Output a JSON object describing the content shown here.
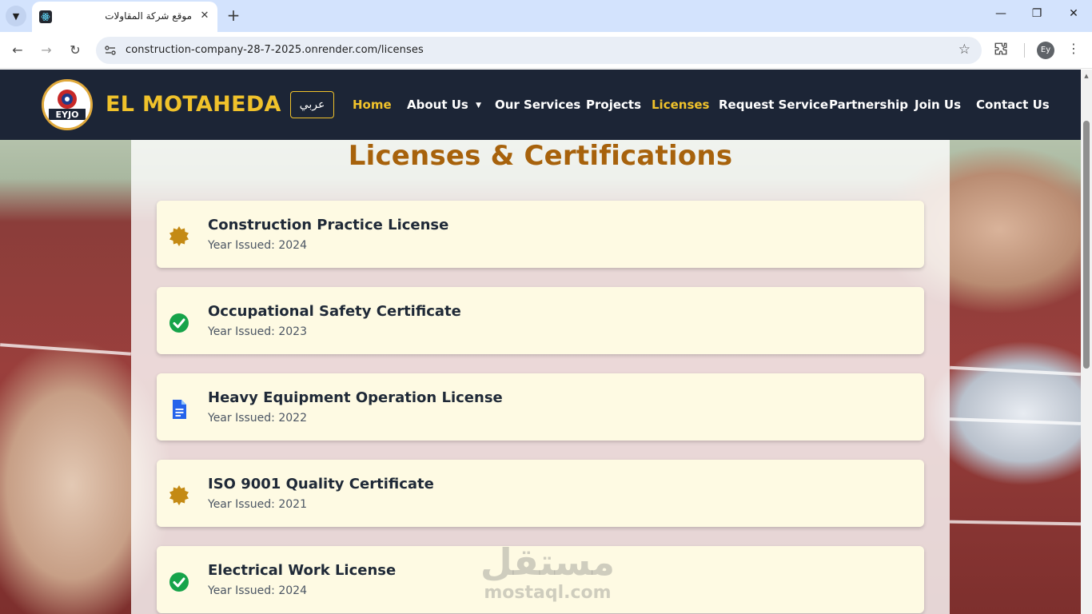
{
  "browser": {
    "tab_title": "موقع شركة المقاولات",
    "url": "construction-company-28-7-2025.onrender.com/licenses",
    "profile_initials": "Ey"
  },
  "site": {
    "brand": "EL MOTAHEDA",
    "logo_text": "EYJO",
    "lang_toggle": "عربي",
    "nav": [
      {
        "label": "Home",
        "active": true
      },
      {
        "label": "About Us",
        "active": false,
        "dropdown": true
      },
      {
        "label": "Our Services",
        "active": false
      },
      {
        "label": "Projects",
        "active": false
      },
      {
        "label": "Licenses",
        "active": true
      },
      {
        "label": "Request Service",
        "active": false
      },
      {
        "label": "Partnership",
        "active": false
      },
      {
        "label": "Join Us",
        "active": false
      },
      {
        "label": "Contact Us",
        "active": false
      }
    ],
    "accent_color": "#f0c22b",
    "header_bg": "#1c2536",
    "title_color": "#a7620c"
  },
  "page": {
    "title": "Licenses & Certifications",
    "licenses": [
      {
        "name": "Construction Practice License",
        "year": "Year Issued: 2024",
        "icon": "badge-icon"
      },
      {
        "name": "Occupational Safety Certificate",
        "year": "Year Issued: 2023",
        "icon": "check-circle-icon"
      },
      {
        "name": "Heavy Equipment Operation License",
        "year": "Year Issued: 2022",
        "icon": "document-icon"
      },
      {
        "name": "ISO 9001 Quality Certificate",
        "year": "Year Issued: 2021",
        "icon": "badge-icon"
      },
      {
        "name": "Electrical Work License",
        "year": "Year Issued: 2024",
        "icon": "check-circle-icon"
      }
    ]
  },
  "watermark": {
    "arabic": "مستقل",
    "latin": "mostaql.com"
  }
}
